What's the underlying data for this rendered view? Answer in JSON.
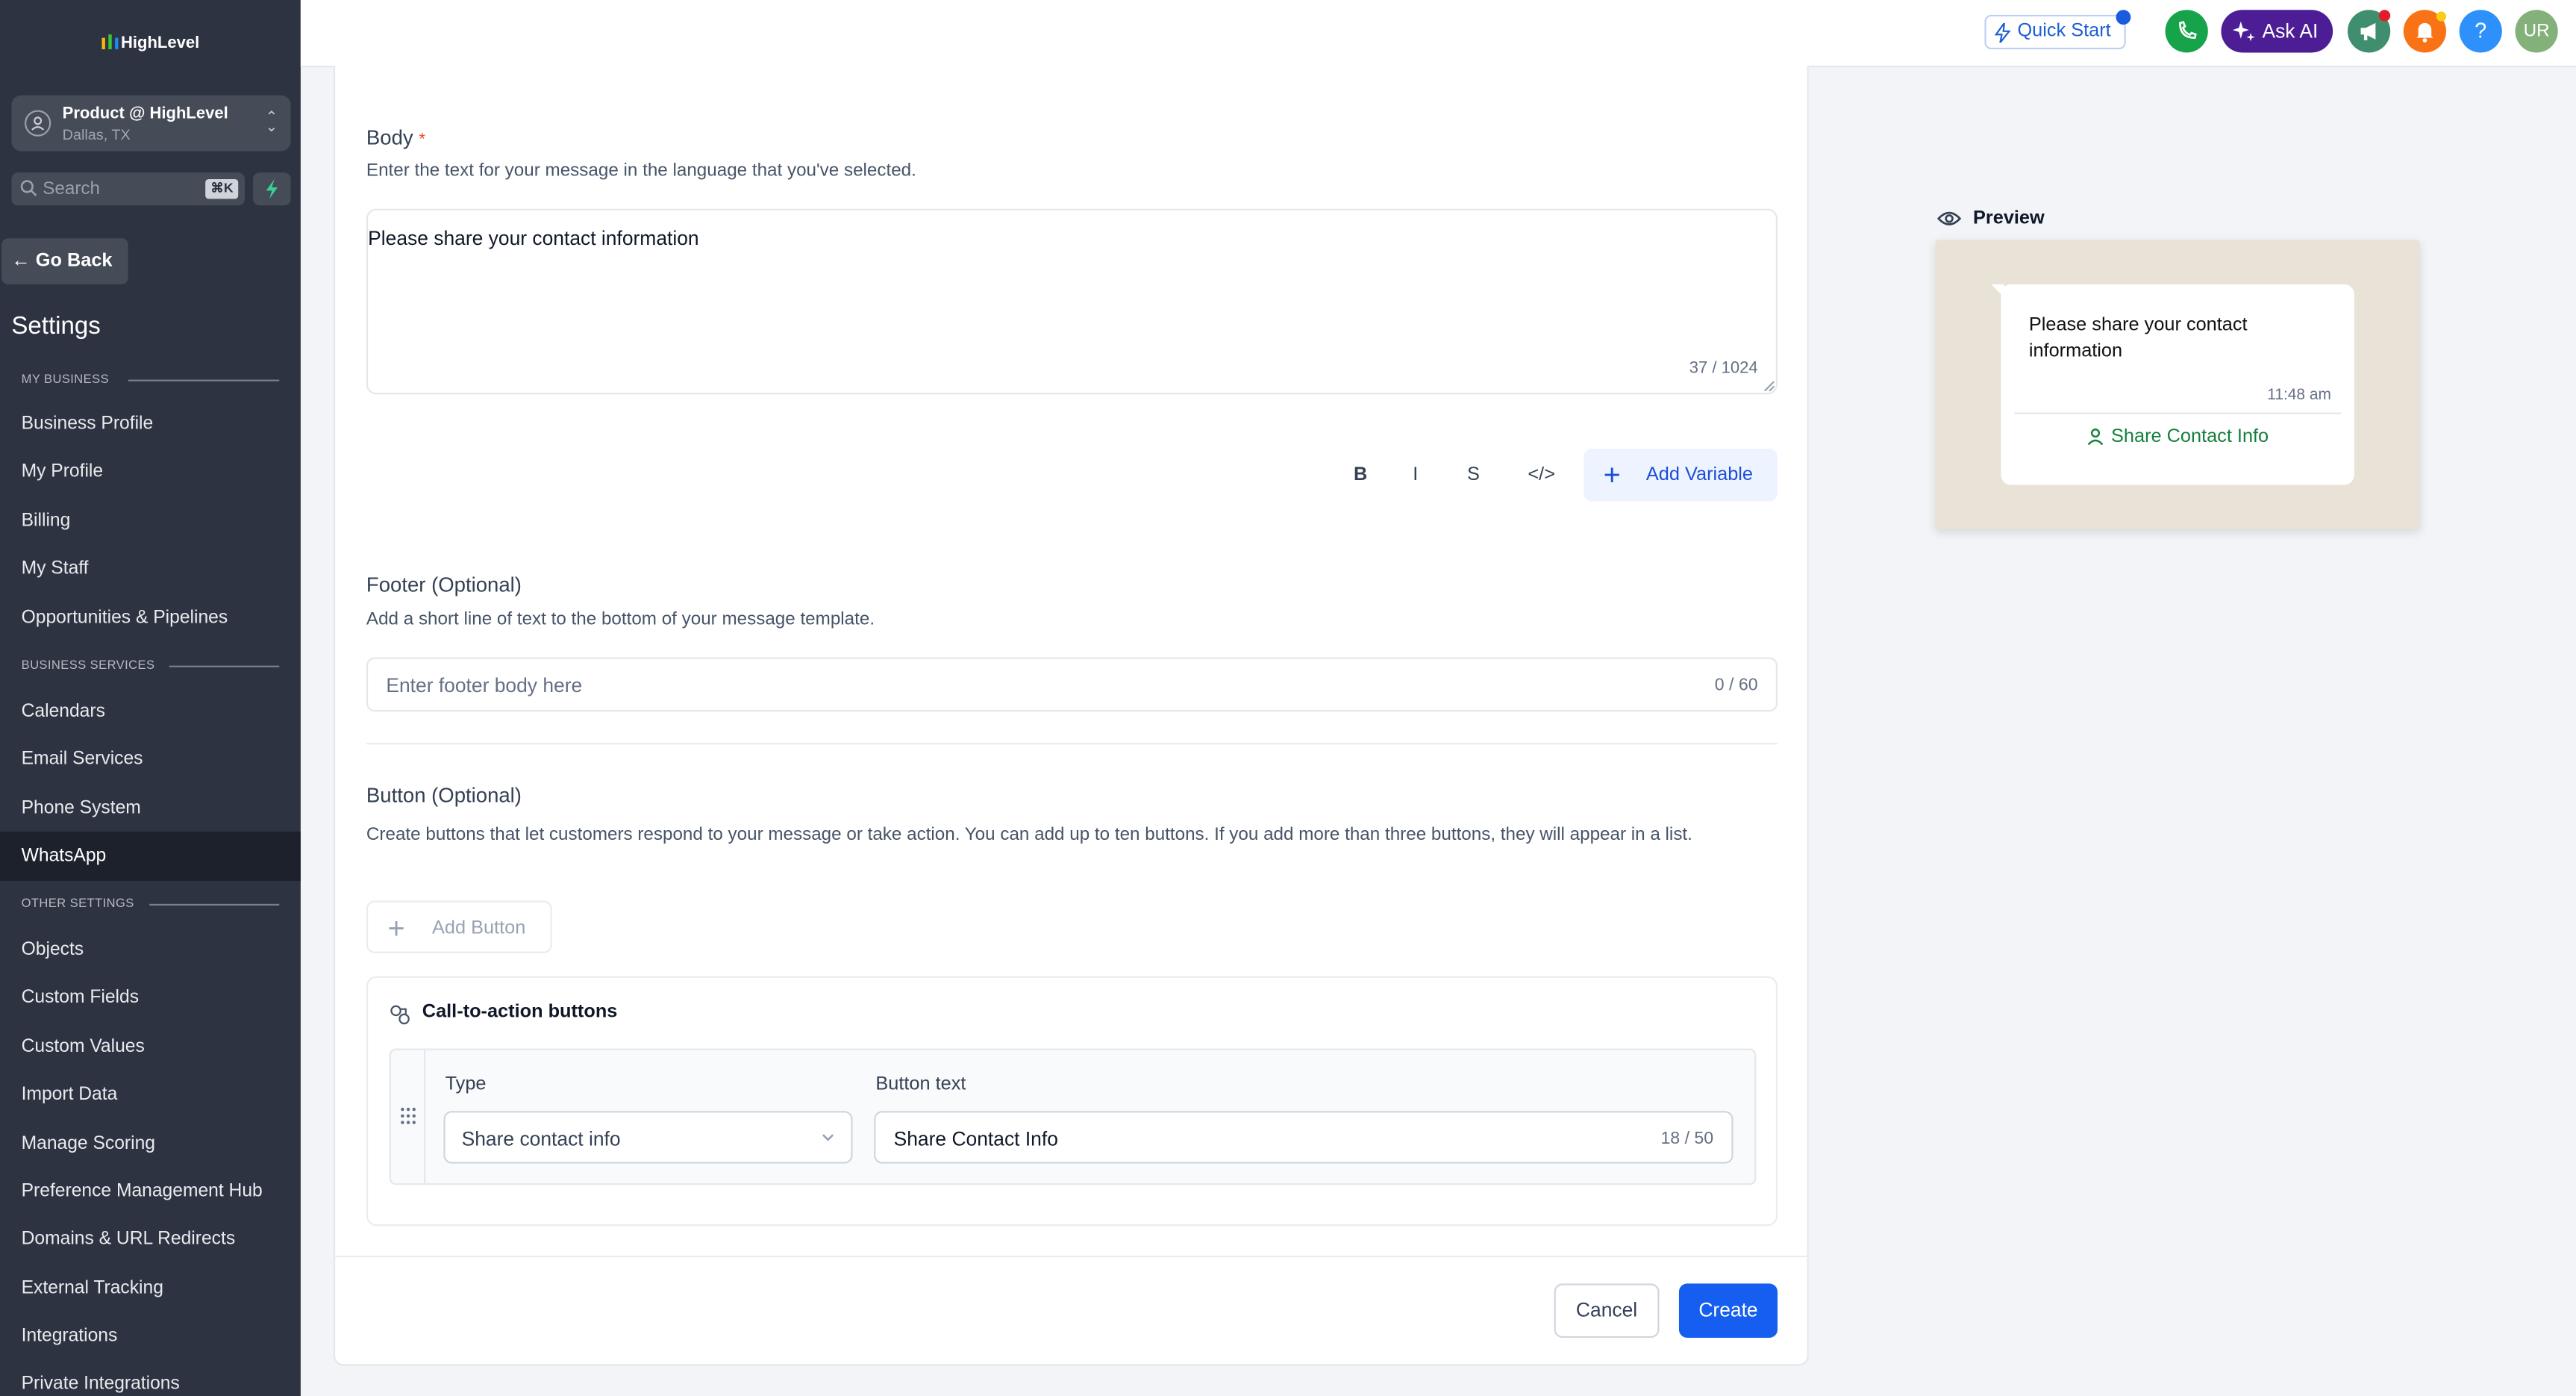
{
  "brand": {
    "logo_text": "HighLevel"
  },
  "account": {
    "name": "Product @ HighLevel",
    "location": "Dallas, TX"
  },
  "search": {
    "placeholder": "Search",
    "shortcut": "⌘K"
  },
  "sidebar": {
    "go_back": "Go Back",
    "title": "Settings",
    "sections": {
      "my_business": "MY BUSINESS",
      "business_services": "BUSINESS SERVICES",
      "other_settings": "OTHER SETTINGS"
    },
    "my_business_items": [
      "Business Profile",
      "My Profile",
      "Billing",
      "My Staff",
      "Opportunities & Pipelines"
    ],
    "business_services_items": [
      "Calendars",
      "Email Services",
      "Phone System",
      "WhatsApp"
    ],
    "other_settings_items": [
      "Objects",
      "Custom Fields",
      "Custom Values",
      "Import Data",
      "Manage Scoring",
      "Preference Management Hub",
      "Domains & URL Redirects",
      "External Tracking",
      "Integrations",
      "Private Integrations"
    ],
    "active_item": "WhatsApp"
  },
  "topbar": {
    "quick_start": "Quick Start",
    "ask_ai": "Ask AI",
    "help": "?",
    "user_initials": "UR",
    "colors": {
      "phone": "#16a34a",
      "announce": "#3f8f6f",
      "bell": "#f97316",
      "help": "#2e90fa",
      "user": "#84b17a"
    }
  },
  "form": {
    "body": {
      "label": "Body",
      "required_mark": "*",
      "description": "Enter the text for your message in the language that you've selected.",
      "value": "Please share your contact information",
      "counter": "37 / 1024"
    },
    "format": {
      "bold": "B",
      "italic": "I",
      "strike": "S",
      "code": "</>",
      "add_variable": "Add Variable"
    },
    "footer": {
      "label": "Footer (Optional)",
      "description": "Add a short line of text to the bottom of your message template.",
      "placeholder": "Enter footer body here",
      "counter": "0 / 60"
    },
    "buttons": {
      "label": "Button (Optional)",
      "description": "Create buttons that let customers respond to your message or take action. You can add up to ten buttons. If you add more than three buttons, they will appear in a list.",
      "add_button": "Add Button",
      "group_title": "Call-to-action buttons",
      "type_label": "Type",
      "type_value": "Share contact info",
      "text_label": "Button text",
      "text_value": "Share Contact Info",
      "text_counter": "18 / 50"
    },
    "actions": {
      "cancel": "Cancel",
      "create": "Create"
    }
  },
  "preview": {
    "title": "Preview",
    "message": "Please share your contact information",
    "time": "11:48 am",
    "button": "Share Contact Info"
  }
}
